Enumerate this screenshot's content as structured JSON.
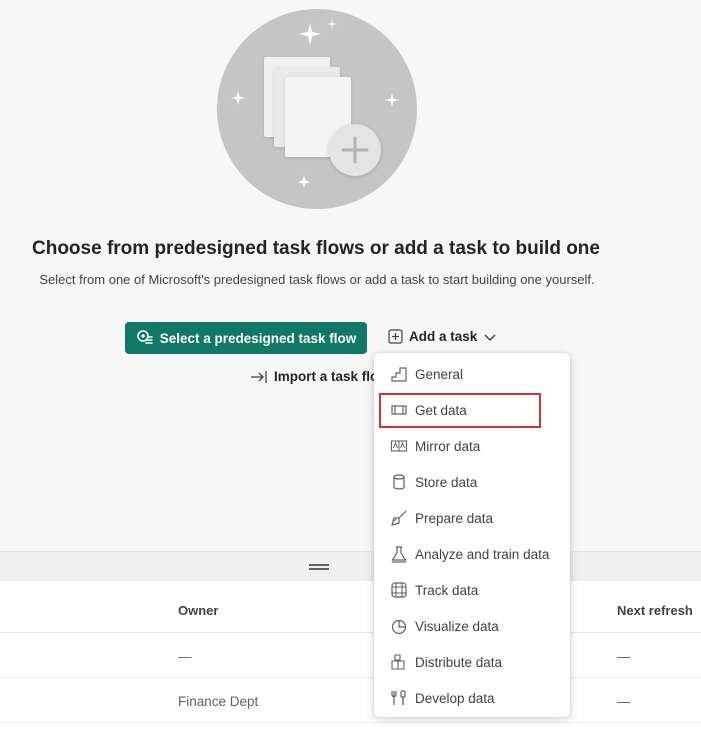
{
  "header": {
    "title": "Choose from predesigned task flows or add a task to build one",
    "subtitle": "Select from one of Microsoft's predesigned task flows or add a task to start building one yourself."
  },
  "actions": {
    "select_flow_label": "Select a predesigned task flow",
    "add_task_label": "Add a task",
    "import_label": "Import a task flo"
  },
  "menu": {
    "items": [
      {
        "label": "General",
        "icon": "general-icon"
      },
      {
        "label": "Get data",
        "icon": "get-data-icon",
        "highlighted": true
      },
      {
        "label": "Mirror data",
        "icon": "mirror-data-icon"
      },
      {
        "label": "Store data",
        "icon": "database-icon"
      },
      {
        "label": "Prepare data",
        "icon": "broom-icon"
      },
      {
        "label": "Analyze and train data",
        "icon": "flask-icon"
      },
      {
        "label": "Track data",
        "icon": "track-data-icon"
      },
      {
        "label": "Visualize data",
        "icon": "pie-chart-icon"
      },
      {
        "label": "Distribute data",
        "icon": "cubes-icon"
      },
      {
        "label": "Develop data",
        "icon": "tools-icon"
      }
    ]
  },
  "table": {
    "columns": {
      "owner": "Owner",
      "next_refresh": "Next refresh"
    },
    "rows": [
      {
        "owner": "—",
        "next_refresh": "—"
      },
      {
        "owner": "Finance Dept",
        "next_refresh": "—"
      }
    ]
  },
  "colors": {
    "primary": "#117865",
    "highlight_border": "#d13438"
  }
}
